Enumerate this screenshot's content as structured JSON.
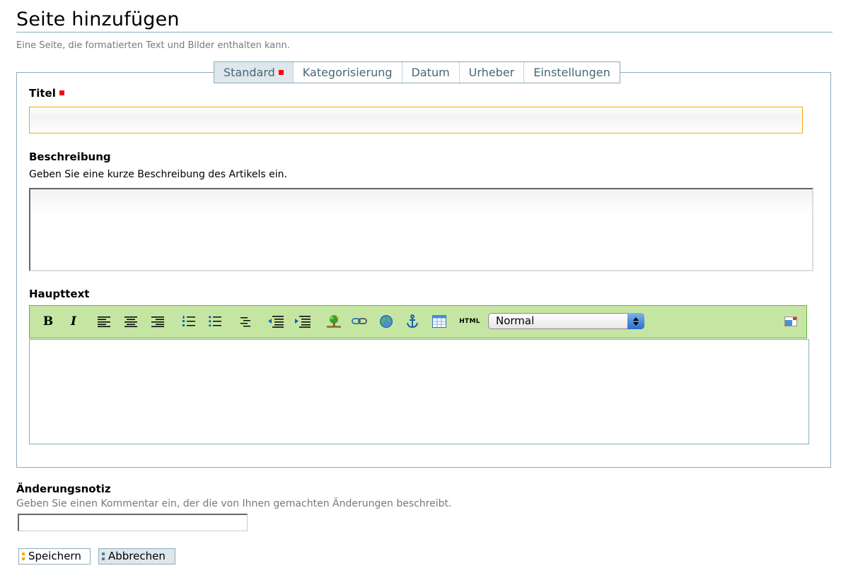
{
  "page": {
    "title": "Seite hinzufügen",
    "description": "Eine Seite, die formatierten Text und Bilder enthalten kann."
  },
  "tabs": [
    {
      "label": "Standard",
      "selected": true,
      "required": true
    },
    {
      "label": "Kategorisierung",
      "selected": false
    },
    {
      "label": "Datum",
      "selected": false
    },
    {
      "label": "Urheber",
      "selected": false
    },
    {
      "label": "Einstellungen",
      "selected": false
    }
  ],
  "fields": {
    "title": {
      "label": "Titel",
      "required": true,
      "value": ""
    },
    "description": {
      "label": "Beschreibung",
      "help": "Geben Sie eine kurze Beschreibung des Artikels ein.",
      "value": ""
    },
    "body": {
      "label": "Haupttext",
      "value": ""
    }
  },
  "editor": {
    "toolbar": {
      "bold": "B",
      "italic": "I",
      "html": "HTML",
      "style_selected": "Normal"
    },
    "icons": [
      "bold-icon",
      "italic-icon",
      "align-left-icon",
      "align-center-icon",
      "align-right-icon",
      "numbered-list-icon",
      "bullet-list-icon",
      "definition-list-icon",
      "outdent-icon",
      "indent-icon",
      "image-icon",
      "link-icon",
      "external-link-icon",
      "anchor-icon",
      "table-icon",
      "html-source-icon",
      "fullscreen-icon"
    ]
  },
  "change_note": {
    "label": "Änderungsnotiz",
    "help": "Geben Sie einen Kommentar ein, der die von Ihnen gemachten Änderungen beschreibt.",
    "value": ""
  },
  "buttons": {
    "save": "Speichern",
    "cancel": "Abbrechen"
  },
  "colors": {
    "accent_border": "#8cacbb",
    "required": "#ff0000",
    "focus": "#ffa500",
    "toolbar_bg": "#c5e6a3"
  }
}
